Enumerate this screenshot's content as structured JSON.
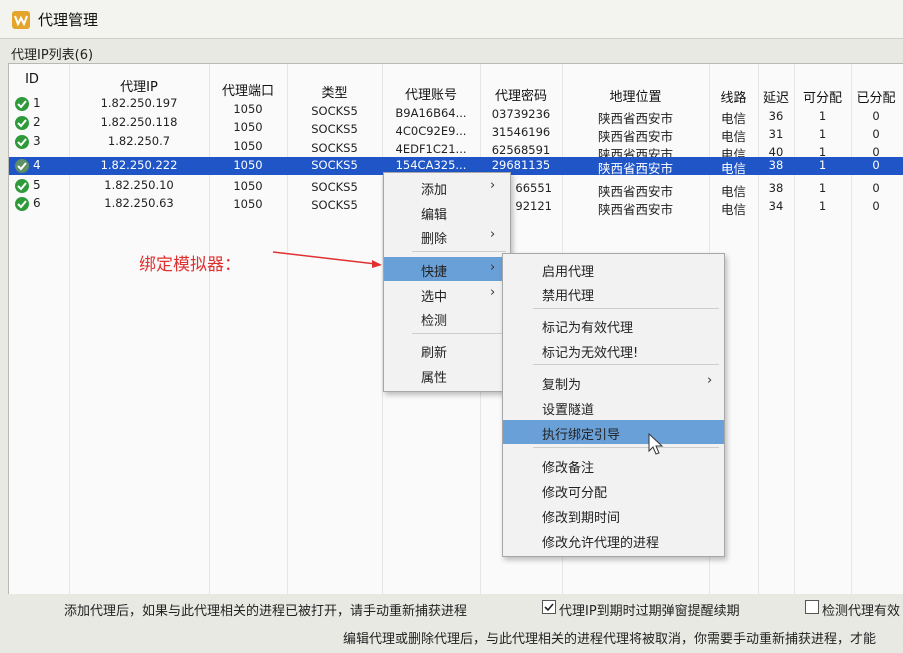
{
  "window": {
    "title": "代理管理"
  },
  "list_caption": "代理IP列表(6)",
  "columns": [
    "ID",
    "代理IP",
    "代理端口",
    "类型",
    "代理账号",
    "代理密码",
    "地理位置",
    "线路",
    "延迟",
    "可分配",
    "已分配"
  ],
  "rows": [
    {
      "id": "1",
      "ip": "1.82.250.197",
      "port": "1050",
      "type": "SOCKS5",
      "account": "B9A16B64...",
      "password": "03739236",
      "location": "陕西省西安市",
      "line": "电信",
      "latency": "36",
      "assignable": "1",
      "assigned": "0"
    },
    {
      "id": "2",
      "ip": "1.82.250.118",
      "port": "1050",
      "type": "SOCKS5",
      "account": "4C0C92E9...",
      "password": "31546196",
      "location": "陕西省西安市",
      "line": "电信",
      "latency": "31",
      "assignable": "1",
      "assigned": "0"
    },
    {
      "id": "3",
      "ip": "1.82.250.7",
      "port": "1050",
      "type": "SOCKS5",
      "account": "4EDF1C21...",
      "password": "62568591",
      "location": "陕西省西安市",
      "line": "电信",
      "latency": "40",
      "assignable": "1",
      "assigned": "0"
    },
    {
      "id": "4",
      "ip": "1.82.250.222",
      "port": "1050",
      "type": "SOCKS5",
      "account": "154CA325...",
      "password": "29681135",
      "location": "陕西省西安市",
      "line": "电信",
      "latency": "38",
      "assignable": "1",
      "assigned": "0"
    },
    {
      "id": "5",
      "ip": "1.82.250.10",
      "port": "1050",
      "type": "SOCKS5",
      "account": "",
      "password": "66551",
      "location": "陕西省西安市",
      "line": "电信",
      "latency": "38",
      "assignable": "1",
      "assigned": "0"
    },
    {
      "id": "6",
      "ip": "1.82.250.63",
      "port": "1050",
      "type": "SOCKS5",
      "account": "",
      "password": "92121",
      "location": "陕西省西安市",
      "line": "电信",
      "latency": "34",
      "assignable": "1",
      "assigned": "0"
    }
  ],
  "context_menu": [
    "添加",
    "编辑",
    "删除",
    "快捷",
    "选中",
    "检测",
    "刷新",
    "属性"
  ],
  "submenu": [
    "启用代理",
    "禁用代理",
    "标记为有效代理",
    "标记为无效代理!",
    "复制为",
    "设置隧道",
    "执行绑定引导",
    "修改备注",
    "修改可分配",
    "修改到期时间",
    "修改允许代理的进程"
  ],
  "annotation": "绑定模拟器：",
  "footer": {
    "note1": "添加代理后，如果与此代理相关的进程已被打开，请手动重新捕获进程",
    "check1_label": "代理IP到期时过期弹窗提醒续期",
    "check2_label": "检测代理有效",
    "note2": "编辑代理或删除代理后，与此代理相关的进程代理将被取消，你需要手动重新捕获进程，才能"
  },
  "colors": {
    "selection": "#1f55c7",
    "menu_highlight": "#6aa0d8",
    "annotation": "#e03131",
    "status_ok": "#2e9a3a"
  }
}
